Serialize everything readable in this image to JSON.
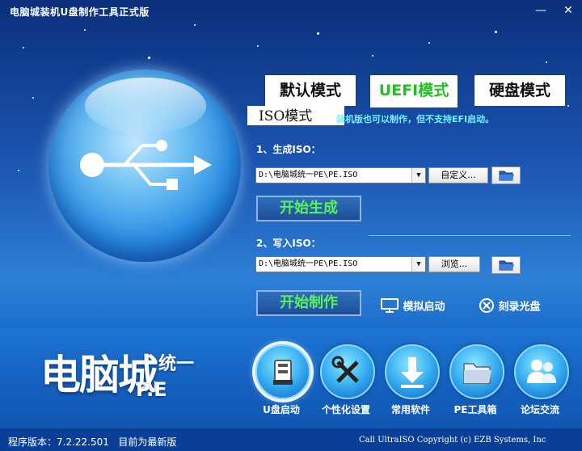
{
  "window": {
    "title": "电脑城装机U盘制作工具正式版",
    "minimize_glyph": "—",
    "close_glyph": "✕"
  },
  "tabs": [
    {
      "label": "默认模式",
      "active": false
    },
    {
      "label": "UEFI模式",
      "active": true
    },
    {
      "label": "硬盘模式",
      "active": false
    }
  ],
  "panel": {
    "title": "ISO模式",
    "note": "装机版也可以制作，但不支持EFI启动。",
    "step1": {
      "label": "1、生成ISO：",
      "path": "D:\\电脑城统一PE\\PE.ISO",
      "custom_button": "自定义...",
      "start_button": "开始生成"
    },
    "step2": {
      "label": "2、写入ISO：",
      "path": "D:\\电脑城统一PE\\PE.ISO",
      "browse_button": "浏览...",
      "start_button": "开始制作"
    },
    "simulate_label": "模拟启动",
    "burn_label": "刻录光盘"
  },
  "logo": {
    "main": "电脑城",
    "side": "统一",
    "pe": "P.E"
  },
  "tools": [
    {
      "label": "U盘启动",
      "icon": "usb-drive-icon",
      "active": true
    },
    {
      "label": "个性化设置",
      "icon": "wrench-screwdriver-icon",
      "active": false
    },
    {
      "label": "常用软件",
      "icon": "download-arrow-icon",
      "active": false
    },
    {
      "label": "PE工具箱",
      "icon": "folder-icon",
      "active": false
    },
    {
      "label": "论坛交流",
      "icon": "users-icon",
      "active": false
    }
  ],
  "status": {
    "version": "程序版本：7.2.22.501",
    "update": "目前为最新版",
    "credit": "Call UltraISO Copyright (c) EZB Systems, Inc"
  },
  "colors": {
    "active_tab_text": "#22c01e",
    "note_text": "#6ef5ff",
    "big_button_text": "#5cf05a",
    "status_bar": "#0a3f98"
  }
}
